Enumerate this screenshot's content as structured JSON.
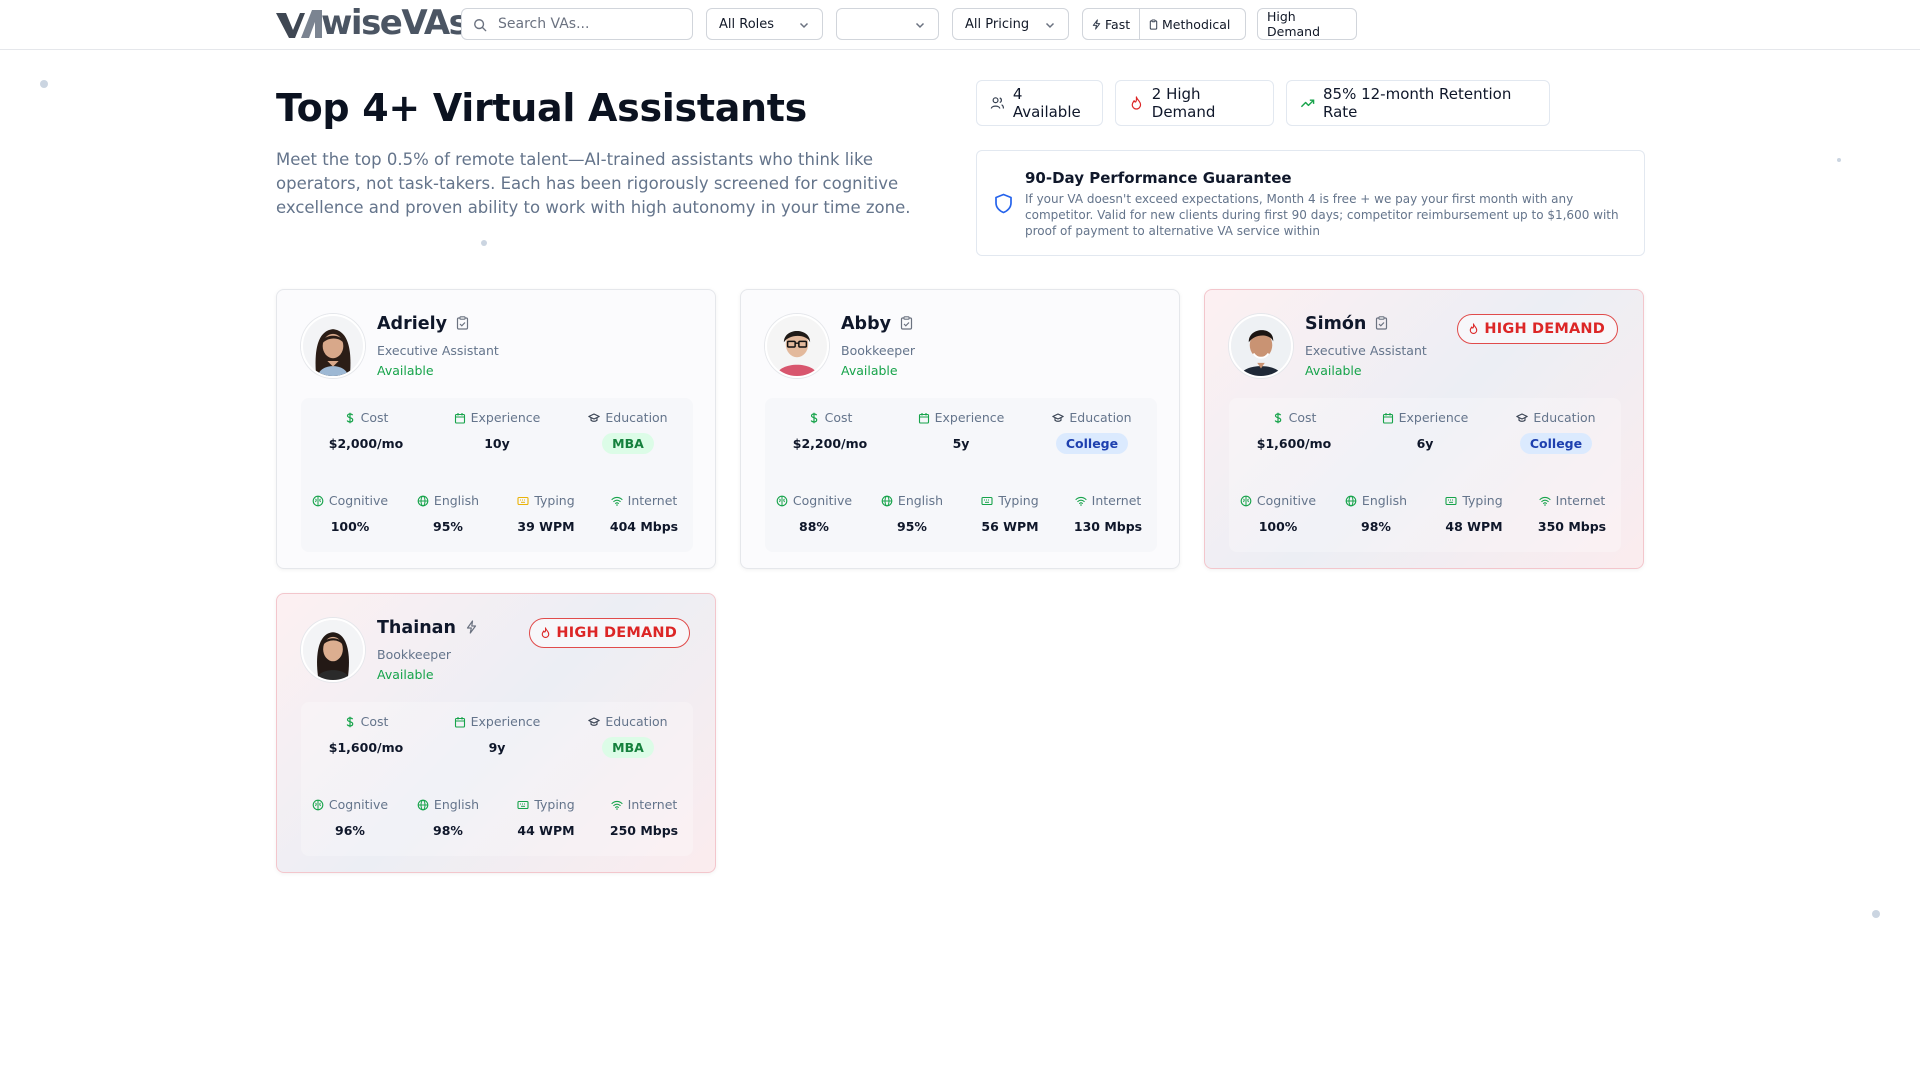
{
  "topbar": {
    "logo_text": "wiseVAs",
    "search_placeholder": "Search VAs...",
    "roles_select": "All Roles",
    "second_select": "",
    "pricing_select": "All Pricing",
    "chip_fast": "Fast",
    "chip_methodical": "Methodical",
    "chip_high_demand": "High Demand"
  },
  "header": {
    "title": "Top 4+ Virtual Assistants",
    "subtitle": "Meet the top 0.5% of remote talent—AI-trained assistants who think like operators, not task-takers. Each has been rigorously screened for cognitive excellence and proven ability to work with high autonomy in your time zone."
  },
  "stats": {
    "available": "4 Available",
    "high_demand": "2 High Demand",
    "retention": "85% 12-month Retention Rate"
  },
  "guarantee": {
    "title": "90-Day Performance Guarantee",
    "text": "If your VA doesn't exceed expectations, Month 4 is free + we pay your first month with any competitor. Valid for new clients during first 90 days; competitor reimbursement up to $1,600 with proof of payment to alternative VA service within"
  },
  "labels": {
    "cost": "Cost",
    "experience": "Experience",
    "education": "Education",
    "cognitive": "Cognitive",
    "english": "English",
    "typing": "Typing",
    "internet": "Internet",
    "high_demand_badge": "HIGH DEMAND"
  },
  "colors": {
    "available_green": "#16a34a",
    "high_demand_red": "#dc2626",
    "mba_bg": "#dcfce7",
    "college_bg": "#dbeafe"
  },
  "vas": [
    {
      "name": "Adriely",
      "role": "Executive Assistant",
      "status": "Available",
      "cost": "$2,000/mo",
      "experience": "10y",
      "education": "MBA",
      "cognitive": "100%",
      "english": "95%",
      "typing": "39 WPM",
      "internet": "404 Mbps",
      "high_demand": false,
      "name_icon": "clipboard-check-icon"
    },
    {
      "name": "Abby",
      "role": "Bookkeeper",
      "status": "Available",
      "cost": "$2,200/mo",
      "experience": "5y",
      "education": "College",
      "cognitive": "88%",
      "english": "95%",
      "typing": "56 WPM",
      "internet": "130 Mbps",
      "high_demand": false,
      "name_icon": "clipboard-check-icon"
    },
    {
      "name": "Simón",
      "role": "Executive Assistant",
      "status": "Available",
      "cost": "$1,600/mo",
      "experience": "6y",
      "education": "College",
      "cognitive": "100%",
      "english": "98%",
      "typing": "48 WPM",
      "internet": "350 Mbps",
      "high_demand": true,
      "name_icon": "clipboard-check-icon"
    },
    {
      "name": "Thainan",
      "role": "Bookkeeper",
      "status": "Available",
      "cost": "$1,600/mo",
      "experience": "9y",
      "education": "MBA",
      "cognitive": "96%",
      "english": "98%",
      "typing": "44 WPM",
      "internet": "250 Mbps",
      "high_demand": true,
      "name_icon": "zap-icon"
    }
  ]
}
